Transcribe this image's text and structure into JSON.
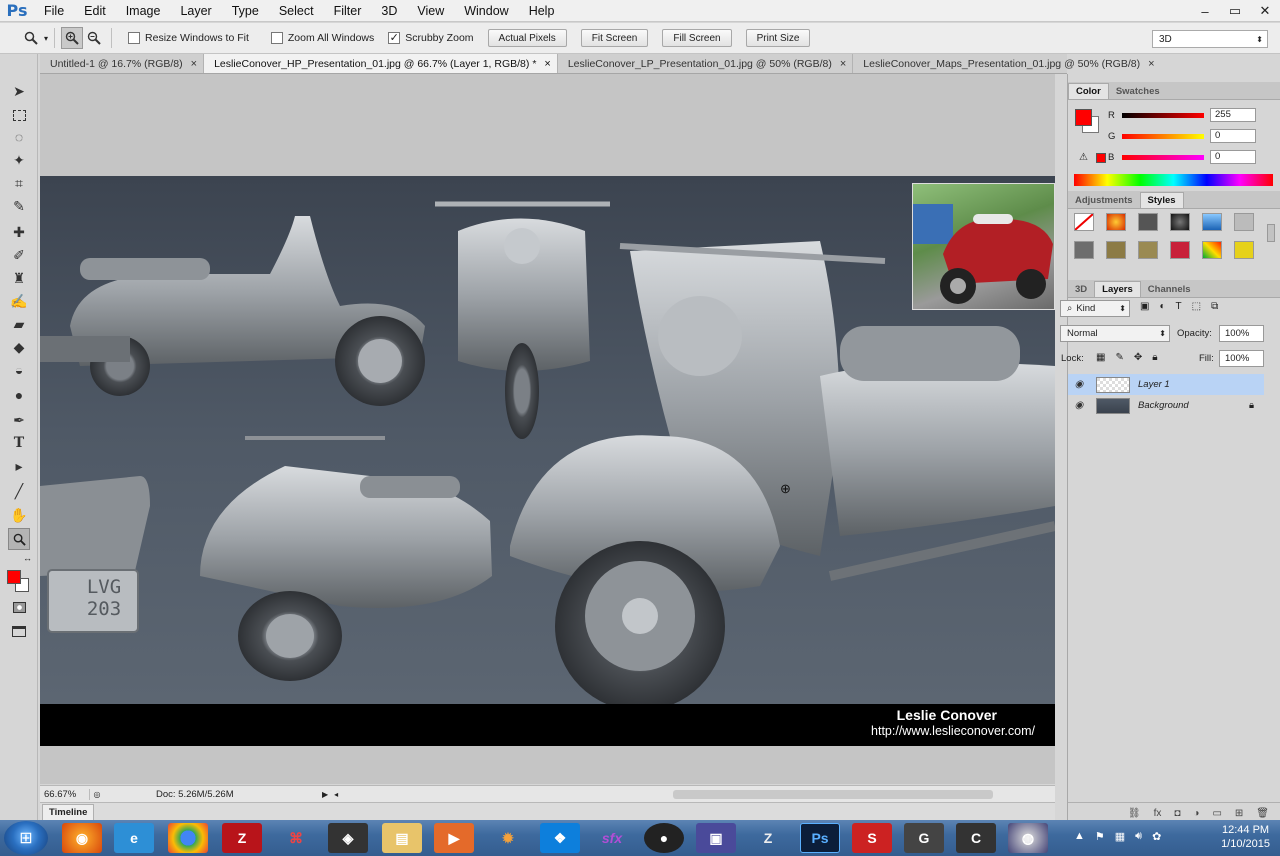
{
  "menubar": {
    "logo": "Ps",
    "items": [
      "File",
      "Edit",
      "Image",
      "Layer",
      "Type",
      "Select",
      "Filter",
      "3D",
      "View",
      "Window",
      "Help"
    ],
    "window_controls": {
      "minimize": "–",
      "restore": "▭",
      "close": "✕"
    }
  },
  "options": {
    "zoom_icon": "zoom-icon",
    "checkboxes": [
      {
        "label": "Resize Windows to Fit",
        "checked": false
      },
      {
        "label": "Zoom All Windows",
        "checked": false
      },
      {
        "label": "Scrubby Zoom",
        "checked": true
      }
    ],
    "buttons": [
      "Actual Pixels",
      "Fit Screen",
      "Fill Screen",
      "Print Size"
    ],
    "workspace": "3D"
  },
  "tabs": [
    {
      "label": "Untitled-1 @ 16.7% (RGB/8)",
      "active": false
    },
    {
      "label": "LeslieConover_HP_Presentation_01.jpg @ 66.7% (Layer 1, RGB/8) *",
      "active": true
    },
    {
      "label": "LeslieConover_LP_Presentation_01.jpg @ 50% (RGB/8)",
      "active": false
    },
    {
      "label": "LeslieConover_Maps_Presentation_01.jpg @ 50% (RGB/8)",
      "active": false
    }
  ],
  "canvas": {
    "credit_name": "Leslie Conover",
    "credit_url": "http://www.leslieconover.com/",
    "plate_line1": "LVG",
    "plate_line2": "203"
  },
  "status": {
    "zoom": "66.67%",
    "doc": "Doc: 5.26M/5.26M"
  },
  "timeline": {
    "label": "Timeline"
  },
  "color_panel": {
    "tabs": [
      "Color",
      "Swatches"
    ],
    "r_label": "R",
    "g_label": "G",
    "b_label": "B",
    "r_value": "255",
    "g_value": "0",
    "b_value": "0",
    "foreground_color": "#ff0000"
  },
  "adjustments_panel": {
    "tabs": [
      "Adjustments",
      "Styles"
    ]
  },
  "layers_panel": {
    "tabs": [
      "3D",
      "Layers",
      "Channels"
    ],
    "filter_kind": "Kind",
    "blend_mode": "Normal",
    "opacity_label": "Opacity:",
    "opacity_value": "100%",
    "lock_label": "Lock:",
    "fill_label": "Fill:",
    "fill_value": "100%",
    "layers": [
      {
        "name": "Layer 1",
        "selected": true
      },
      {
        "name": "Background",
        "selected": false,
        "locked": true
      }
    ]
  },
  "taskbar": {
    "apps": [
      "firefox",
      "internet-explorer",
      "chrome",
      "filezilla",
      "sketchbook",
      "unity",
      "file-explorer",
      "media-player",
      "zbrush-alt",
      "dropbox",
      "sfx",
      "bomb",
      "terminal",
      "zbrush",
      "photoshop",
      "substance",
      "app-g",
      "app-c",
      "app-ball"
    ],
    "ps_label": "Ps",
    "time": "12:44 PM",
    "date": "1/10/2015"
  }
}
